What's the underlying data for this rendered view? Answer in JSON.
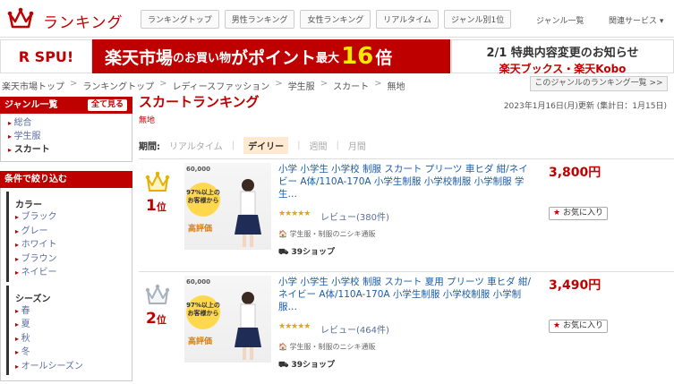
{
  "header": {
    "title": "ランキング",
    "tabs": [
      "ランキングトップ",
      "男性ランキング",
      "女性ランキング",
      "リアルタイム",
      "ジャンル別1位"
    ],
    "genre_list": "ジャンル一覧",
    "related": "関連サービス ▾"
  },
  "banner": {
    "spu": "R SPU!",
    "main_1": "楽天市場",
    "main_2": "のお買い物",
    "main_3": "がポイント",
    "main_4": "最大",
    "main_5": "16",
    "main_6": "倍",
    "side_1": "2/1 特典内容変更のお知らせ",
    "side_2": "楽天ブックス・楽天Kobo"
  },
  "breadcrumb": [
    "楽天市場トップ",
    "ランキングトップ",
    "レディースファッション",
    "学生服",
    "スカート",
    "無地"
  ],
  "genre_ranking_link": "このジャンルのランキング一覧 >>",
  "sidebar": {
    "genre_title": "ジャンル一覧",
    "show_all": "全て見る",
    "genres": [
      "総合",
      "学生服",
      "スカート"
    ],
    "filter_title": "条件で絞り込む",
    "color_title": "カラー",
    "colors": [
      "ブラック",
      "グレー",
      "ホワイト",
      "ブラウン",
      "ネイビー"
    ],
    "season_title": "シーズン",
    "seasons": [
      "春",
      "夏",
      "秋",
      "冬",
      "オールシーズン"
    ]
  },
  "main": {
    "title": "スカートランキング",
    "subtitle": "無地",
    "updated": "2023年1月16日(月)更新 (集計日：1月15日)",
    "period_label": "期間:",
    "periods": [
      "リアルタイム",
      "デイリー",
      "週間",
      "月間"
    ],
    "active_period": "デイリー"
  },
  "items": [
    {
      "rank": "1",
      "rank_suffix": "位",
      "crown": "gold",
      "title": "小学 小学生 小学校 制服 スカート プリーツ 車ヒダ 紺/ネイビー A体/110A-170A 小学生制服 小学校制服 小学制服 学生…",
      "price": "3,800円",
      "stars": "★★★★★",
      "review": "レビュー(380件)",
      "shop": "学生服・制服のニシキ通販",
      "shop_count": "39ショップ",
      "fav": "お気に入り",
      "thumb_count": "60,000",
      "thumb_bubble_1": "97%以上の",
      "thumb_bubble_2": "お客様から",
      "thumb_high": "高評価"
    },
    {
      "rank": "2",
      "rank_suffix": "位",
      "crown": "silver",
      "title": "小学 小学生 小学校 制服 スカート 夏用 プリーツ 車ヒダ 紺/ネイビー A体/110A-170A 小学生制服 小学校制服 小学制服…",
      "price": "3,490円",
      "stars": "★★★★★",
      "review": "レビュー(464件)",
      "shop": "学生服・制服のニシキ通販",
      "shop_count": "39ショップ",
      "fav": "お気に入り",
      "thumb_count": "60,000",
      "thumb_bubble_1": "97%以上の",
      "thumb_bubble_2": "お客様から",
      "thumb_high": "高評価"
    }
  ]
}
